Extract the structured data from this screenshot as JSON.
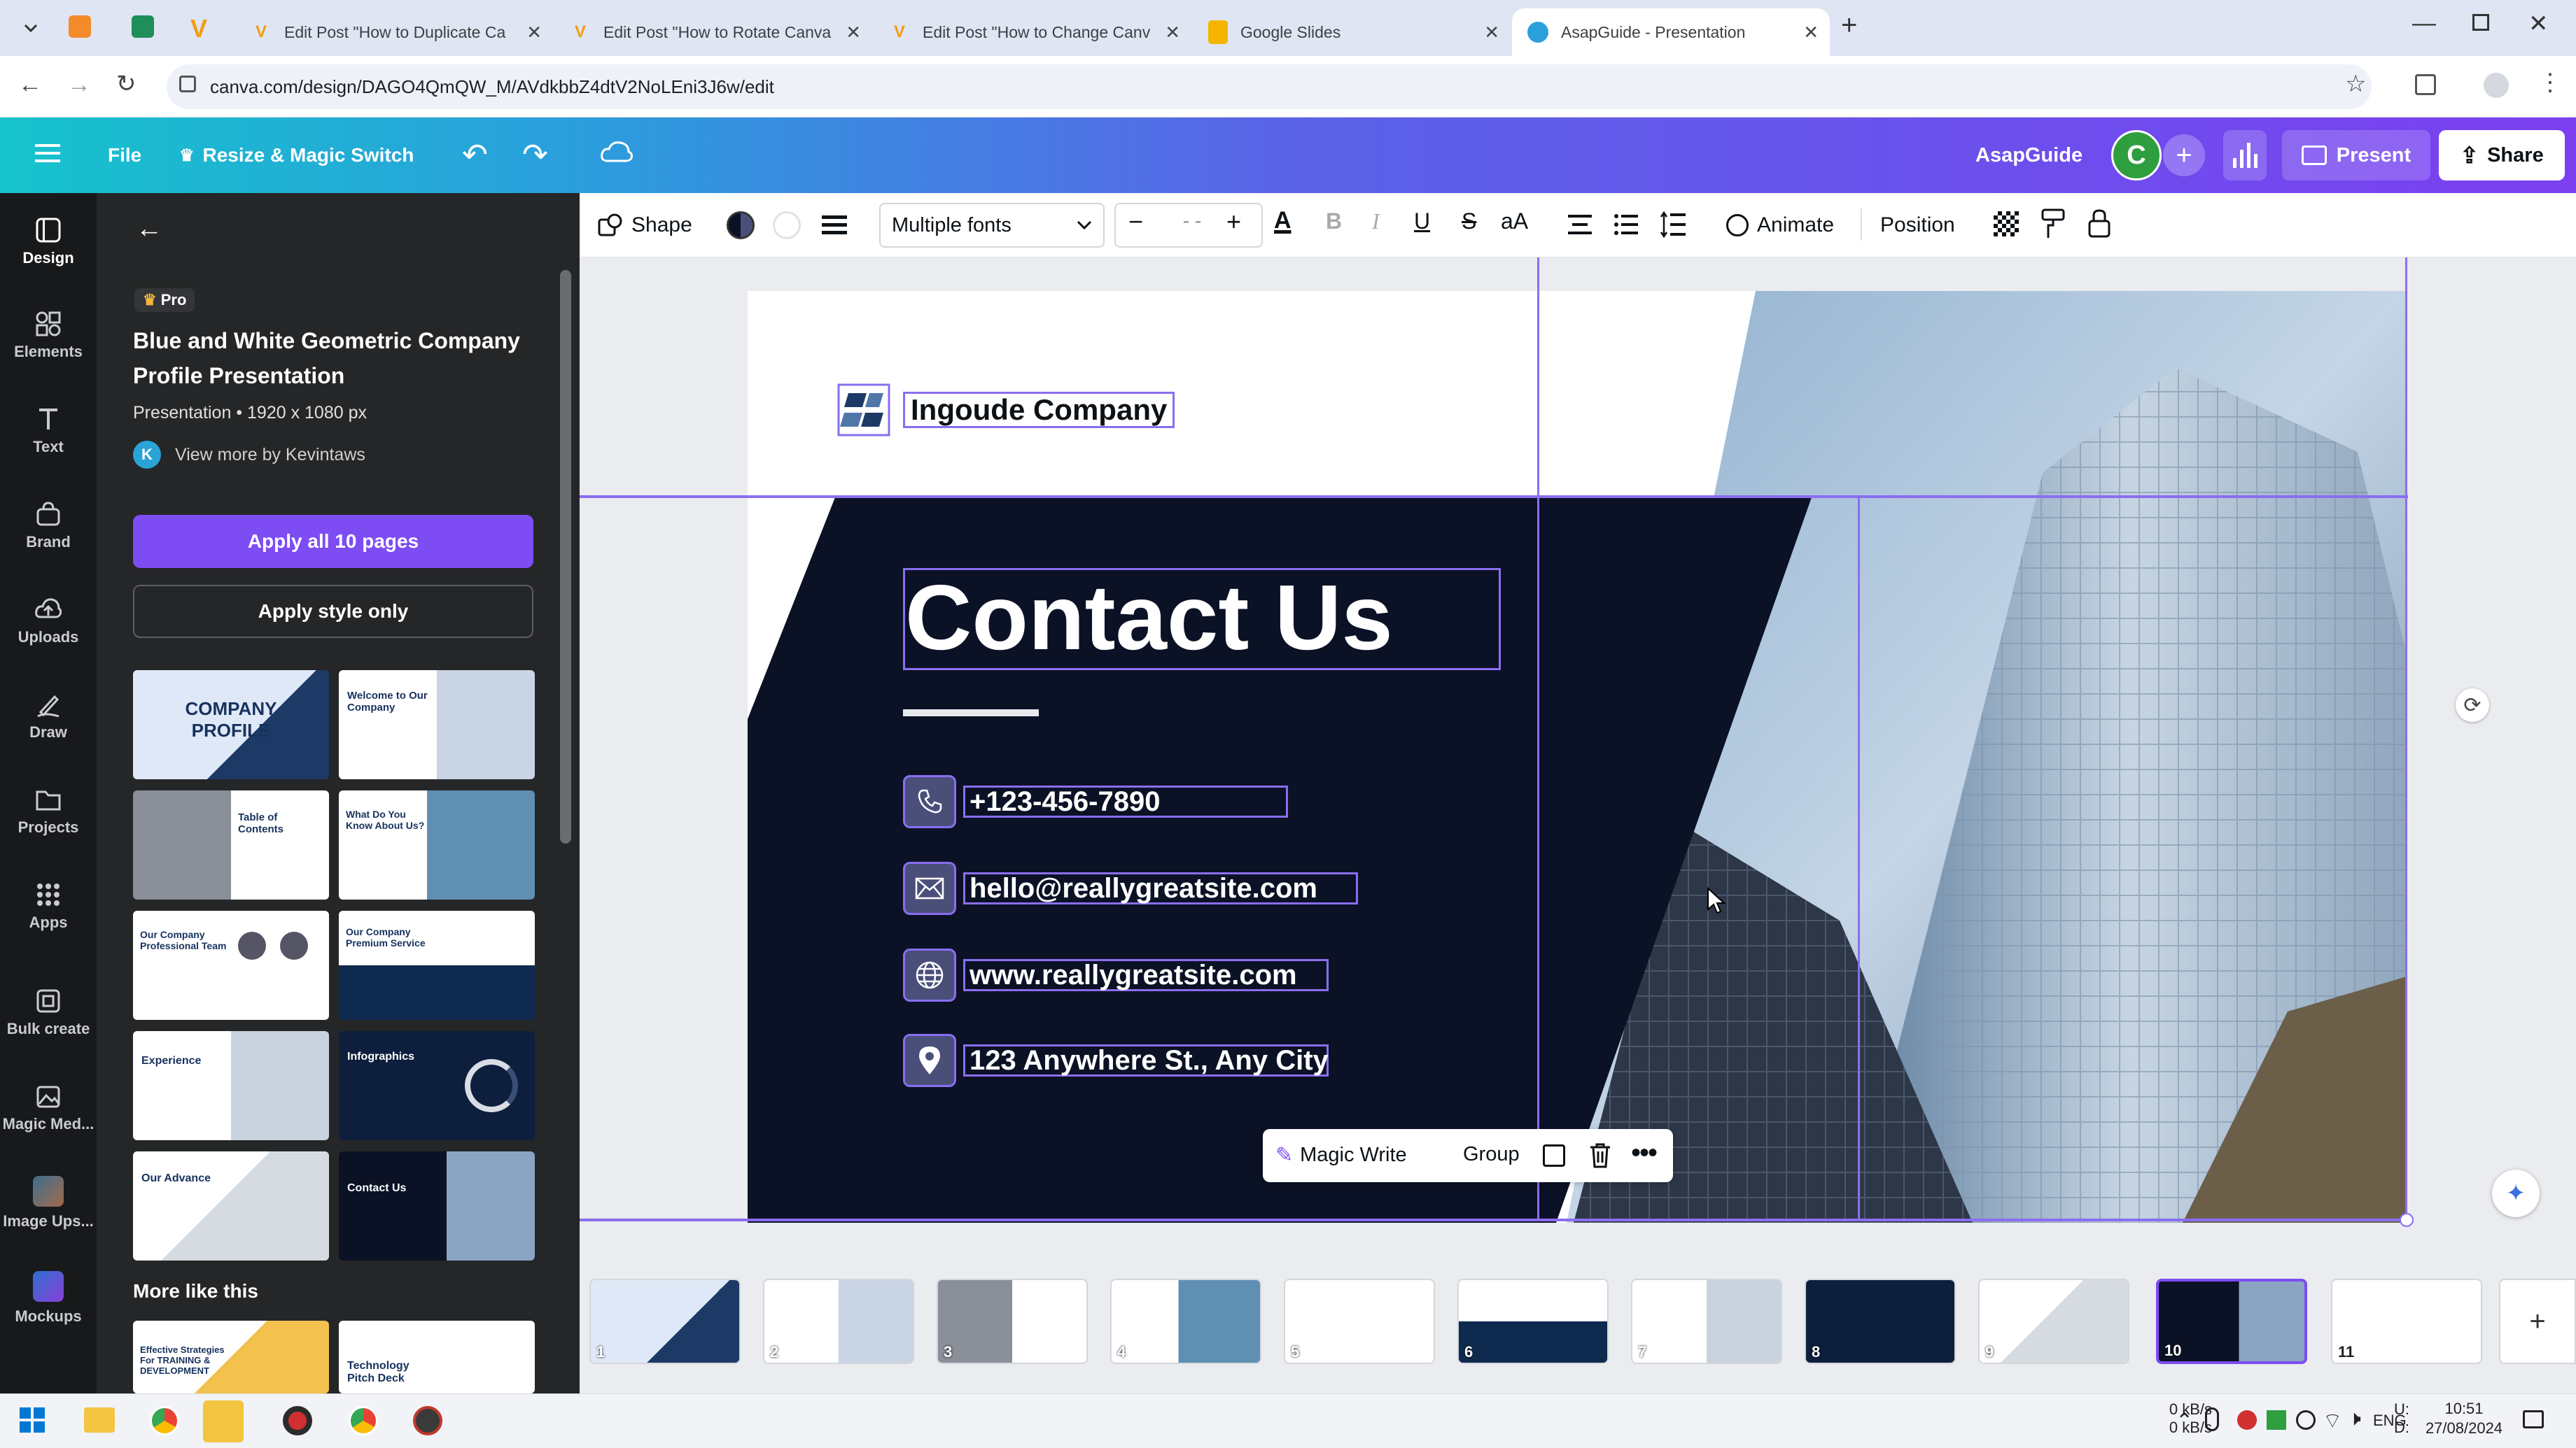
{
  "browser": {
    "tabs": [
      {
        "title": "Edit Post \"How to Duplicate Ca"
      },
      {
        "title": "Edit Post \"How to Rotate Canva"
      },
      {
        "title": "Edit Post \"How to Change Canv"
      },
      {
        "title": "Google Slides"
      },
      {
        "title": "AsapGuide - Presentation"
      }
    ],
    "url": "canva.com/design/DAGO4QmQW_M/AVdkbbZ4dtV2NoLEni3J6w/edit"
  },
  "header": {
    "file_label": "File",
    "resize_label": "Resize & Magic Switch",
    "team_name": "AsapGuide",
    "avatar_letter": "C",
    "present_label": "Present",
    "share_label": "Share"
  },
  "rail": {
    "items": [
      {
        "label": "Design",
        "icon": "design-icon"
      },
      {
        "label": "Elements",
        "icon": "elements-icon"
      },
      {
        "label": "Text",
        "icon": "text-icon"
      },
      {
        "label": "Brand",
        "icon": "brand-icon"
      },
      {
        "label": "Uploads",
        "icon": "uploads-icon"
      },
      {
        "label": "Draw",
        "icon": "draw-icon"
      },
      {
        "label": "Projects",
        "icon": "projects-icon"
      },
      {
        "label": "Apps",
        "icon": "apps-icon"
      },
      {
        "label": "Bulk create",
        "icon": "bulk-create-icon"
      },
      {
        "label": "Magic Med...",
        "icon": "magic-media-icon"
      },
      {
        "label": "Image Ups...",
        "icon": "image-upscaler-icon"
      },
      {
        "label": "Mockups",
        "icon": "mockups-icon"
      }
    ]
  },
  "panel": {
    "pro_badge": "Pro",
    "template_title": "Blue and White Geometric Company Profile Presentation",
    "template_meta": "Presentation • 1920 x 1080 px",
    "author_initial": "K",
    "author_link": "View more by Kevintaws",
    "apply_all_label": "Apply all 10 pages",
    "apply_style_label": "Apply style only",
    "thumbnails": [
      {
        "title": "COMPANY PROFILE"
      },
      {
        "title": "Welcome to Our Company"
      },
      {
        "title": "Table of Contents"
      },
      {
        "title": "What Do You Know About Us?"
      },
      {
        "title": "Our Company Professional Team"
      },
      {
        "title": "Our Company Premium Service"
      },
      {
        "title": "Experience"
      },
      {
        "title": "Infographics"
      },
      {
        "title": "Our Advance"
      },
      {
        "title": "Contact Us"
      }
    ],
    "more_like_this": "More like this",
    "more_items": [
      {
        "title": "Effective Strategies For TRAINING & DEVELOPMENT"
      },
      {
        "title": "Technology Pitch Deck"
      }
    ]
  },
  "toolbar": {
    "shape_label": "Shape",
    "font_label": "Multiple fonts",
    "font_size": "- -",
    "animate_label": "Animate",
    "position_label": "Position"
  },
  "slide": {
    "company": "Ingoude Company",
    "heading": "Contact Us",
    "phone": "+123-456-7890",
    "email": "hello@reallygreatsite.com",
    "website": "www.reallygreatsite.com",
    "address": "123 Anywhere St., Any City"
  },
  "floating_toolbar": {
    "magic_write": "Magic Write",
    "group": "Group"
  },
  "filmstrip": {
    "pages": [
      "1",
      "2",
      "3",
      "4",
      "5",
      "6",
      "7",
      "8",
      "9",
      "10",
      "11"
    ],
    "current_page": "10"
  },
  "taskbar": {
    "net_up_label": "U:",
    "net_down_label": "D:",
    "net_up": "0 kB/s",
    "net_down": "0 kB/s",
    "lang": "ENG",
    "time": "10:51",
    "date": "27/08/2024"
  },
  "colors": {
    "accent_purple": "#7d4cf2",
    "slide_navy": "#0b1226",
    "selection": "#8a6ef0"
  }
}
